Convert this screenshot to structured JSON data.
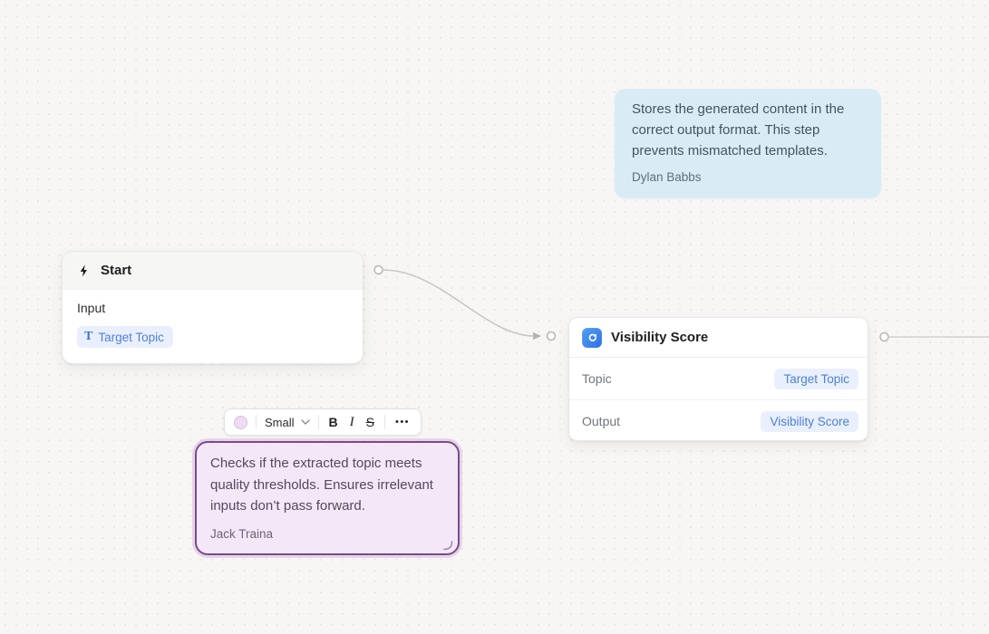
{
  "canvas": {
    "label": "workflow-canvas"
  },
  "comments": {
    "teal": {
      "text": "Stores the generated content in the correct output format. This step prevents mismatched templates.",
      "author": "Dylan Babbs",
      "bg": "#d9ecf6"
    },
    "purple": {
      "text": "Checks if the extracted topic meets quality thresholds. Ensures irrelevant inputs don’t pass forward.",
      "author": "Jack Traina",
      "bg": "#f3e7f8",
      "border": "#7b4a8c"
    }
  },
  "nodes": {
    "start": {
      "title": "Start",
      "icon": "lightning-bolt",
      "section_label": "Input",
      "pill_icon": "T",
      "pill": "Target Topic"
    },
    "visibility": {
      "title": "Visibility Score",
      "icon": "blue-swoosh-arrow-app",
      "rows": [
        {
          "label": "Topic",
          "value": "Target Topic"
        },
        {
          "label": "Output",
          "value": "Visibility Score"
        }
      ]
    }
  },
  "toolbar": {
    "color_swatch": "light-purple",
    "size_label": "Small",
    "bold_label": "B",
    "italic_label": "I",
    "strikethrough_label": "S",
    "more_label": "•••"
  },
  "colors": {
    "canvas_bg": "#f7f6f4",
    "canvas_dot": "#e9e6e2",
    "accent_blue": "#4d82d8",
    "pill_bg": "#e9effc",
    "connector_line": "#c9c7c4",
    "node_border": "#e8e7e5"
  }
}
